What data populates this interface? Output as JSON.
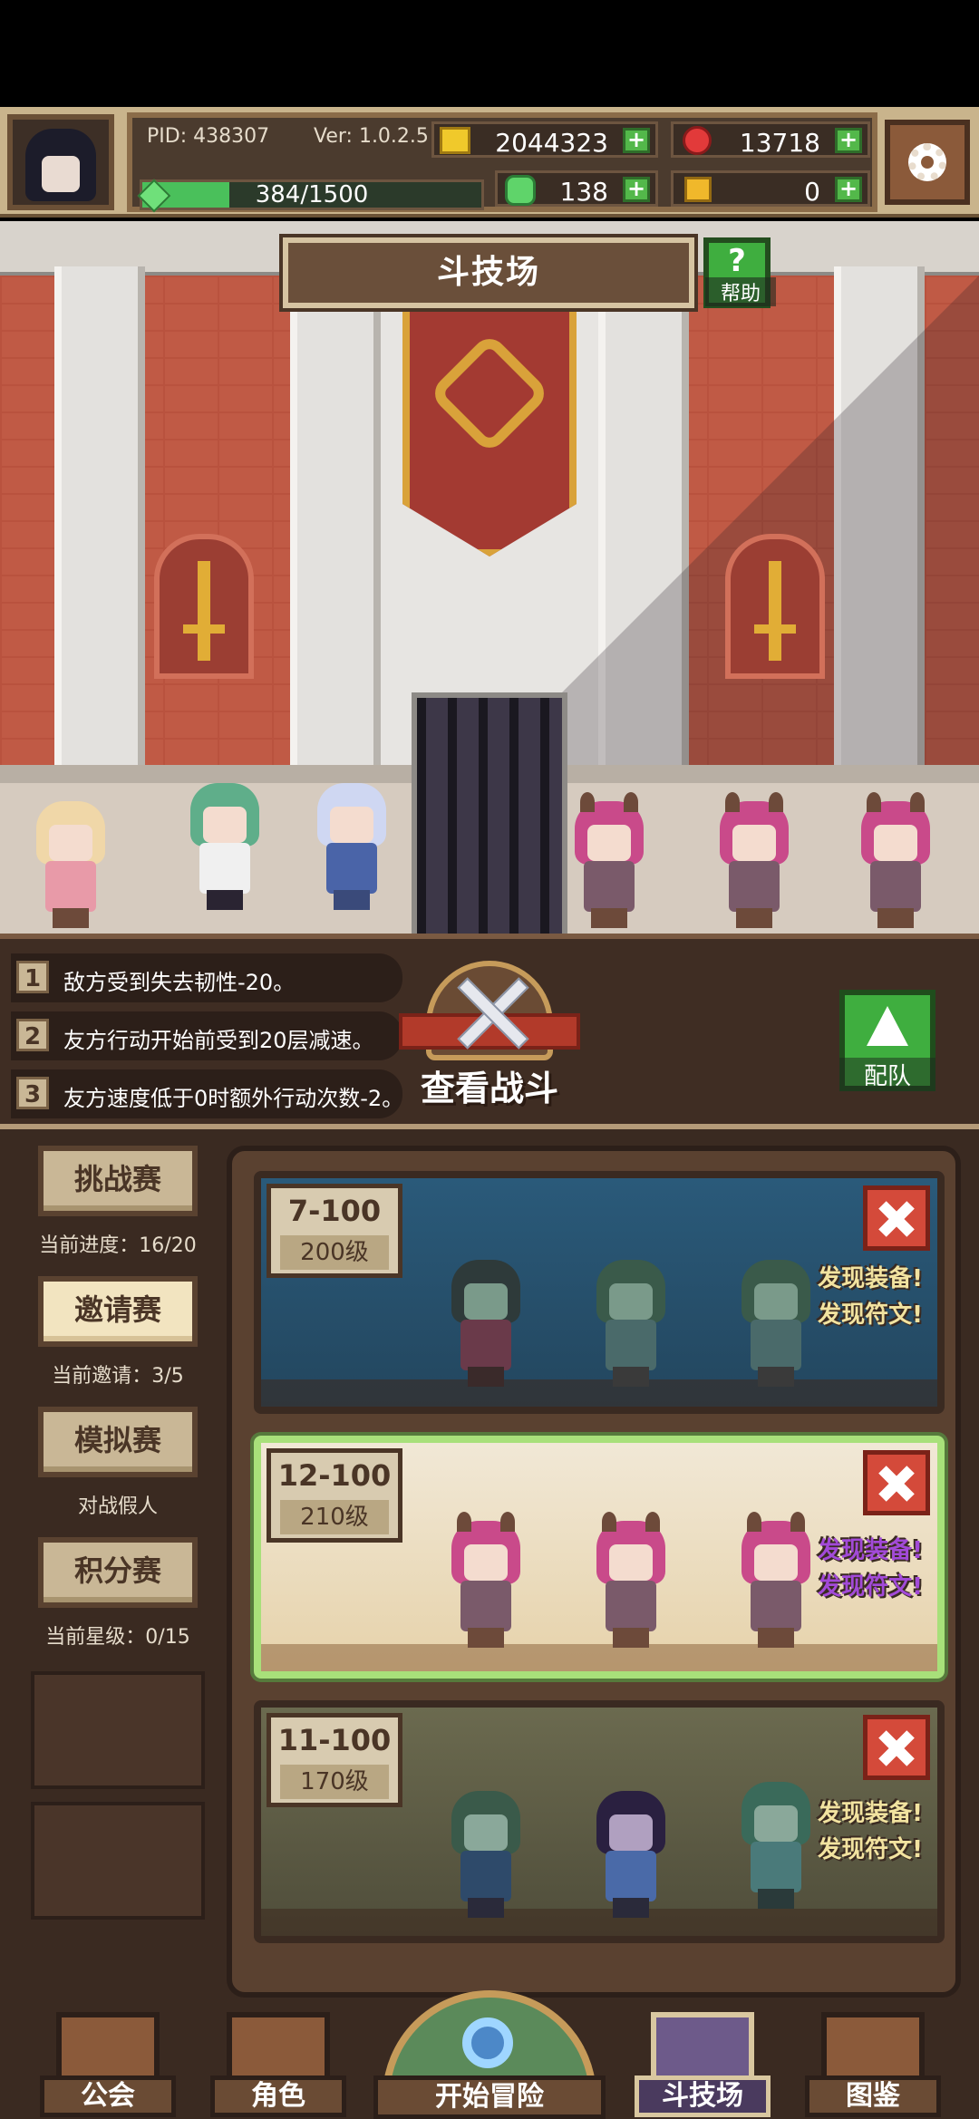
{
  "header": {
    "pid": "PID: 438307",
    "version": "Ver: 1.0.2.5",
    "gold": "2044323",
    "gems": "13718",
    "xp": "384/1500",
    "xp_progress": 0.256,
    "clover": "138",
    "keys": "0"
  },
  "arena": {
    "title": "斗技场",
    "help_label": "帮助"
  },
  "rules": [
    {
      "num": "1",
      "text": "敌方受到失去韧性-20。"
    },
    {
      "num": "2",
      "text": "友方行动开始前受到20层减速。"
    },
    {
      "num": "3",
      "text": "友方速度低于0时额外行动次数-2。"
    }
  ],
  "view_battle": "查看战斗",
  "team_label": "配队",
  "side_menu": [
    {
      "label": "挑战赛",
      "sub": "当前进度：16/20"
    },
    {
      "label": "邀请赛",
      "sub": "当前邀请：3/5"
    },
    {
      "label": "模拟赛",
      "sub": "对战假人"
    },
    {
      "label": "积分赛",
      "sub": "当前星级：0/15"
    }
  ],
  "stages": [
    {
      "name": "7-100",
      "level": "200级",
      "drop1": "发现装备!",
      "drop2": "发现符文!"
    },
    {
      "name": "12-100",
      "level": "210级",
      "drop1": "发现装备!",
      "drop2": "发现符文!"
    },
    {
      "name": "11-100",
      "level": "170级",
      "drop1": "发现装备!",
      "drop2": "发现符文!"
    }
  ],
  "nav": {
    "guild": "公会",
    "character": "角色",
    "adventure": "开始冒险",
    "arena": "斗技场",
    "codex": "图鉴"
  },
  "colors": {
    "accent_green": "#3fae3f",
    "panel_brown": "#3a2a21",
    "close_red": "#d44a3a"
  }
}
